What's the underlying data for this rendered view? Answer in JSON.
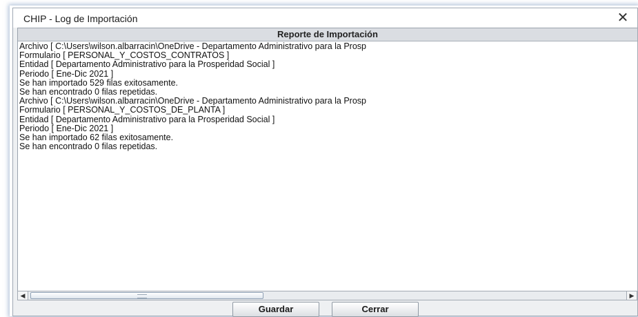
{
  "window": {
    "title": "CHIP - Log de Importación",
    "close_glyph": "✕"
  },
  "report": {
    "header": "Reporte de Importación",
    "lines": [
      "Archivo [ C:\\Users\\wilson.albarracin\\OneDrive - Departamento Administrativo para la Prosp",
      "Formulario [ PERSONAL_Y_COSTOS_CONTRATOS ]",
      "Entidad [ Departamento Administrativo para la Prosperidad Social ]",
      "Periodo [ Ene-Dic 2021 ]",
      "Se han importado 529 filas exitosamente.",
      "Se han encontrado 0 filas repetidas.",
      "Archivo [ C:\\Users\\wilson.albarracin\\OneDrive - Departamento Administrativo para la Prosp",
      "Formulario [ PERSONAL_Y_COSTOS_DE_PLANTA ]",
      "Entidad [ Departamento Administrativo para la Prosperidad Social ]",
      "Periodo [ Ene-Dic 2021 ]",
      "Se han importado 62 filas exitosamente.",
      "Se han encontrado 0 filas repetidas."
    ]
  },
  "scrollbar": {
    "left_arrow": "◀",
    "right_arrow": "▶"
  },
  "buttons": {
    "save_label": "Guardar",
    "close_label": "Cerrar"
  }
}
